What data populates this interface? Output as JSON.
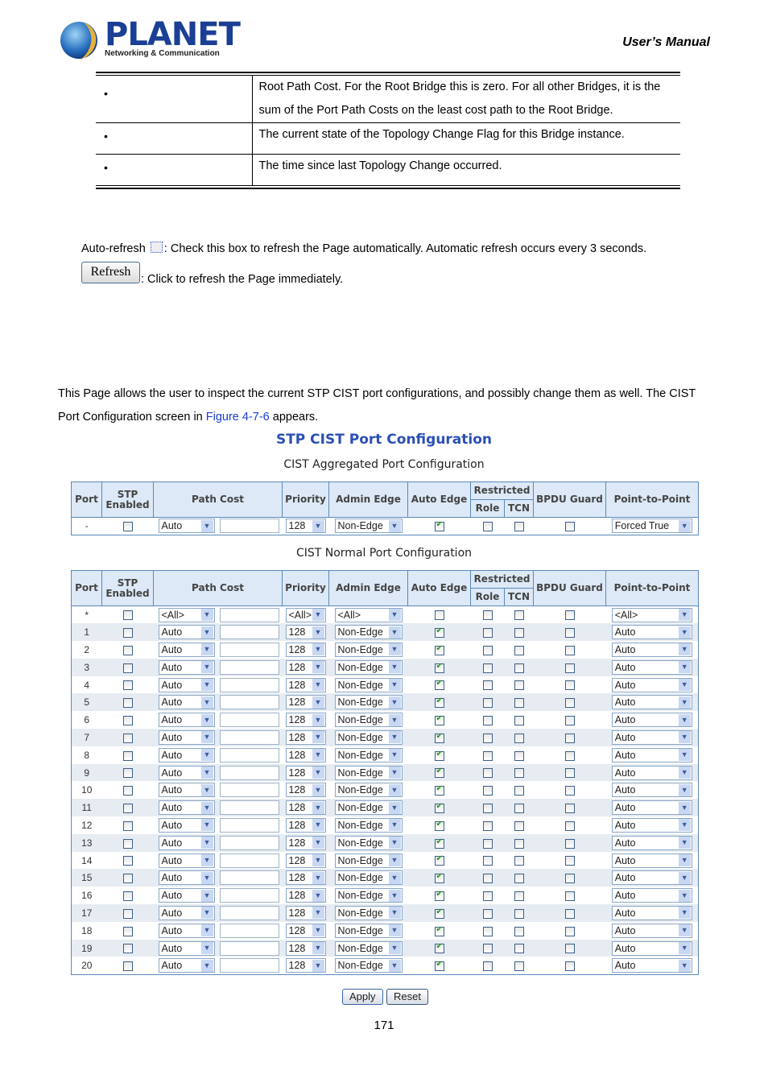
{
  "header": {
    "brand": "PLANET",
    "brand_tagline": "Networking & Communication",
    "doc_title": "User’s  Manual"
  },
  "desc_table": [
    {
      "bullet": "•",
      "text": "Root Path Cost. For the Root Bridge this is zero. For all other Bridges, it is the sum of the Port Path Costs on the least cost path to the Root Bridge."
    },
    {
      "bullet": "•",
      "text": "The current state of the Topology Change Flag for this Bridge instance."
    },
    {
      "bullet": "•",
      "text": "The time since last Topology Change occurred."
    }
  ],
  "auto_refresh": {
    "label": "Auto-refresh",
    "desc": ": Check this box to refresh the Page automatically. Automatic refresh occurs every 3 seconds.",
    "checked": false
  },
  "refresh": {
    "label": "Refresh",
    "desc": ": Click to refresh the Page immediately."
  },
  "intro": {
    "line1": "This Page allows the user to inspect the current STP CIST port configurations, and possibly change them as well. The CIST",
    "line2_pre": "Port Configuration screen in ",
    "link": "Figure 4-7-6",
    "line2_post": " appears."
  },
  "figure": {
    "title": "STP CIST Port Configuration",
    "aggregated_title": "CIST Aggregated Port Configuration",
    "normal_title": "CIST Normal Port Configuration"
  },
  "columns": {
    "port": "Port",
    "stp_enabled": "STP Enabled",
    "path_cost": "Path Cost",
    "priority": "Priority",
    "admin_edge": "Admin Edge",
    "auto_edge": "Auto Edge",
    "restricted": "Restricted",
    "role": "Role",
    "tcn": "TCN",
    "bpdu_guard": "BPDU Guard",
    "p2p": "Point-to-Point"
  },
  "aggregated": [
    {
      "port": "-",
      "stp": false,
      "path_cost": "Auto",
      "path_value": "",
      "priority": "128",
      "admin_edge": "Non-Edge",
      "auto_edge": true,
      "role": false,
      "tcn": false,
      "bpdu": false,
      "p2p": "Forced True"
    }
  ],
  "normal": [
    {
      "port": "*",
      "stp": false,
      "path_cost": "<All>",
      "path_value": "",
      "priority": "<All>",
      "admin_edge": "<All>",
      "auto_edge": false,
      "role": false,
      "tcn": false,
      "bpdu": false,
      "p2p": "<All>"
    },
    {
      "port": "1",
      "stp": false,
      "path_cost": "Auto",
      "path_value": "",
      "priority": "128",
      "admin_edge": "Non-Edge",
      "auto_edge": true,
      "role": false,
      "tcn": false,
      "bpdu": false,
      "p2p": "Auto"
    },
    {
      "port": "2",
      "stp": false,
      "path_cost": "Auto",
      "path_value": "",
      "priority": "128",
      "admin_edge": "Non-Edge",
      "auto_edge": true,
      "role": false,
      "tcn": false,
      "bpdu": false,
      "p2p": "Auto"
    },
    {
      "port": "3",
      "stp": false,
      "path_cost": "Auto",
      "path_value": "",
      "priority": "128",
      "admin_edge": "Non-Edge",
      "auto_edge": true,
      "role": false,
      "tcn": false,
      "bpdu": false,
      "p2p": "Auto"
    },
    {
      "port": "4",
      "stp": false,
      "path_cost": "Auto",
      "path_value": "",
      "priority": "128",
      "admin_edge": "Non-Edge",
      "auto_edge": true,
      "role": false,
      "tcn": false,
      "bpdu": false,
      "p2p": "Auto"
    },
    {
      "port": "5",
      "stp": false,
      "path_cost": "Auto",
      "path_value": "",
      "priority": "128",
      "admin_edge": "Non-Edge",
      "auto_edge": true,
      "role": false,
      "tcn": false,
      "bpdu": false,
      "p2p": "Auto"
    },
    {
      "port": "6",
      "stp": false,
      "path_cost": "Auto",
      "path_value": "",
      "priority": "128",
      "admin_edge": "Non-Edge",
      "auto_edge": true,
      "role": false,
      "tcn": false,
      "bpdu": false,
      "p2p": "Auto"
    },
    {
      "port": "7",
      "stp": false,
      "path_cost": "Auto",
      "path_value": "",
      "priority": "128",
      "admin_edge": "Non-Edge",
      "auto_edge": true,
      "role": false,
      "tcn": false,
      "bpdu": false,
      "p2p": "Auto"
    },
    {
      "port": "8",
      "stp": false,
      "path_cost": "Auto",
      "path_value": "",
      "priority": "128",
      "admin_edge": "Non-Edge",
      "auto_edge": true,
      "role": false,
      "tcn": false,
      "bpdu": false,
      "p2p": "Auto"
    },
    {
      "port": "9",
      "stp": false,
      "path_cost": "Auto",
      "path_value": "",
      "priority": "128",
      "admin_edge": "Non-Edge",
      "auto_edge": true,
      "role": false,
      "tcn": false,
      "bpdu": false,
      "p2p": "Auto"
    },
    {
      "port": "10",
      "stp": false,
      "path_cost": "Auto",
      "path_value": "",
      "priority": "128",
      "admin_edge": "Non-Edge",
      "auto_edge": true,
      "role": false,
      "tcn": false,
      "bpdu": false,
      "p2p": "Auto"
    },
    {
      "port": "11",
      "stp": false,
      "path_cost": "Auto",
      "path_value": "",
      "priority": "128",
      "admin_edge": "Non-Edge",
      "auto_edge": true,
      "role": false,
      "tcn": false,
      "bpdu": false,
      "p2p": "Auto"
    },
    {
      "port": "12",
      "stp": false,
      "path_cost": "Auto",
      "path_value": "",
      "priority": "128",
      "admin_edge": "Non-Edge",
      "auto_edge": true,
      "role": false,
      "tcn": false,
      "bpdu": false,
      "p2p": "Auto"
    },
    {
      "port": "13",
      "stp": false,
      "path_cost": "Auto",
      "path_value": "",
      "priority": "128",
      "admin_edge": "Non-Edge",
      "auto_edge": true,
      "role": false,
      "tcn": false,
      "bpdu": false,
      "p2p": "Auto"
    },
    {
      "port": "14",
      "stp": false,
      "path_cost": "Auto",
      "path_value": "",
      "priority": "128",
      "admin_edge": "Non-Edge",
      "auto_edge": true,
      "role": false,
      "tcn": false,
      "bpdu": false,
      "p2p": "Auto"
    },
    {
      "port": "15",
      "stp": false,
      "path_cost": "Auto",
      "path_value": "",
      "priority": "128",
      "admin_edge": "Non-Edge",
      "auto_edge": true,
      "role": false,
      "tcn": false,
      "bpdu": false,
      "p2p": "Auto"
    },
    {
      "port": "16",
      "stp": false,
      "path_cost": "Auto",
      "path_value": "",
      "priority": "128",
      "admin_edge": "Non-Edge",
      "auto_edge": true,
      "role": false,
      "tcn": false,
      "bpdu": false,
      "p2p": "Auto"
    },
    {
      "port": "17",
      "stp": false,
      "path_cost": "Auto",
      "path_value": "",
      "priority": "128",
      "admin_edge": "Non-Edge",
      "auto_edge": true,
      "role": false,
      "tcn": false,
      "bpdu": false,
      "p2p": "Auto"
    },
    {
      "port": "18",
      "stp": false,
      "path_cost": "Auto",
      "path_value": "",
      "priority": "128",
      "admin_edge": "Non-Edge",
      "auto_edge": true,
      "role": false,
      "tcn": false,
      "bpdu": false,
      "p2p": "Auto"
    },
    {
      "port": "19",
      "stp": false,
      "path_cost": "Auto",
      "path_value": "",
      "priority": "128",
      "admin_edge": "Non-Edge",
      "auto_edge": true,
      "role": false,
      "tcn": false,
      "bpdu": false,
      "p2p": "Auto"
    },
    {
      "port": "20",
      "stp": false,
      "path_cost": "Auto",
      "path_value": "",
      "priority": "128",
      "admin_edge": "Non-Edge",
      "auto_edge": true,
      "role": false,
      "tcn": false,
      "bpdu": false,
      "p2p": "Auto"
    }
  ],
  "buttons": {
    "apply": "Apply",
    "reset": "Reset"
  },
  "page_number": "171",
  "colors": {
    "header_bg": "#dde9f7",
    "border": "#5a88bb",
    "title": "#2a4fb5",
    "link": "#1a3cd8",
    "alt_row": "#e6ecf2"
  }
}
